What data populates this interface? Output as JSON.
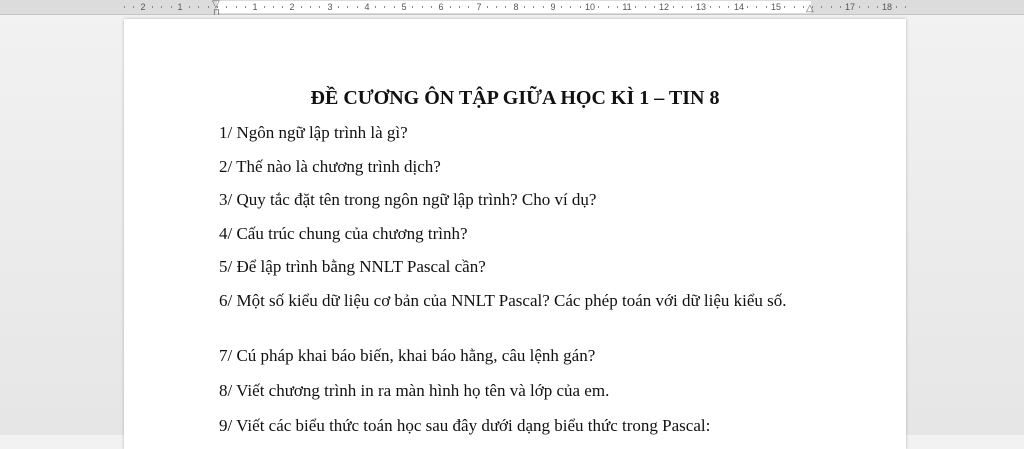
{
  "ruler": {
    "numbers": [
      "2",
      "1",
      "1",
      "2",
      "3",
      "4",
      "5",
      "6",
      "7",
      "8",
      "9",
      "10",
      "11",
      "12",
      "13",
      "14",
      "15",
      "17",
      "18"
    ]
  },
  "document": {
    "title": "ĐỀ CƯƠNG ÔN TẬP GIỮA HỌC KÌ 1 – TIN 8",
    "questions": [
      "1/ Ngôn ngữ lập trình là gì?",
      "2/ Thế nào là chương trình dịch?",
      "3/ Quy tắc đặt tên trong ngôn ngữ lập trình? Cho ví dụ?",
      "4/ Cấu trúc chung của chương trình?",
      "5/ Để lập trình bằng NNLT Pascal cần?",
      "6/ Một số kiểu dữ liệu cơ bản của NNLT Pascal? Các phép toán với dữ liệu kiểu số.",
      "7/ Cú pháp khai báo biến, khai báo hằng, câu lệnh gán?",
      "8/ Viết chương trình in ra màn hình họ tên và lớp của em.",
      "9/ Viết các biểu thức toán học sau đây dưới dạng biểu thức trong Pascal:"
    ]
  }
}
